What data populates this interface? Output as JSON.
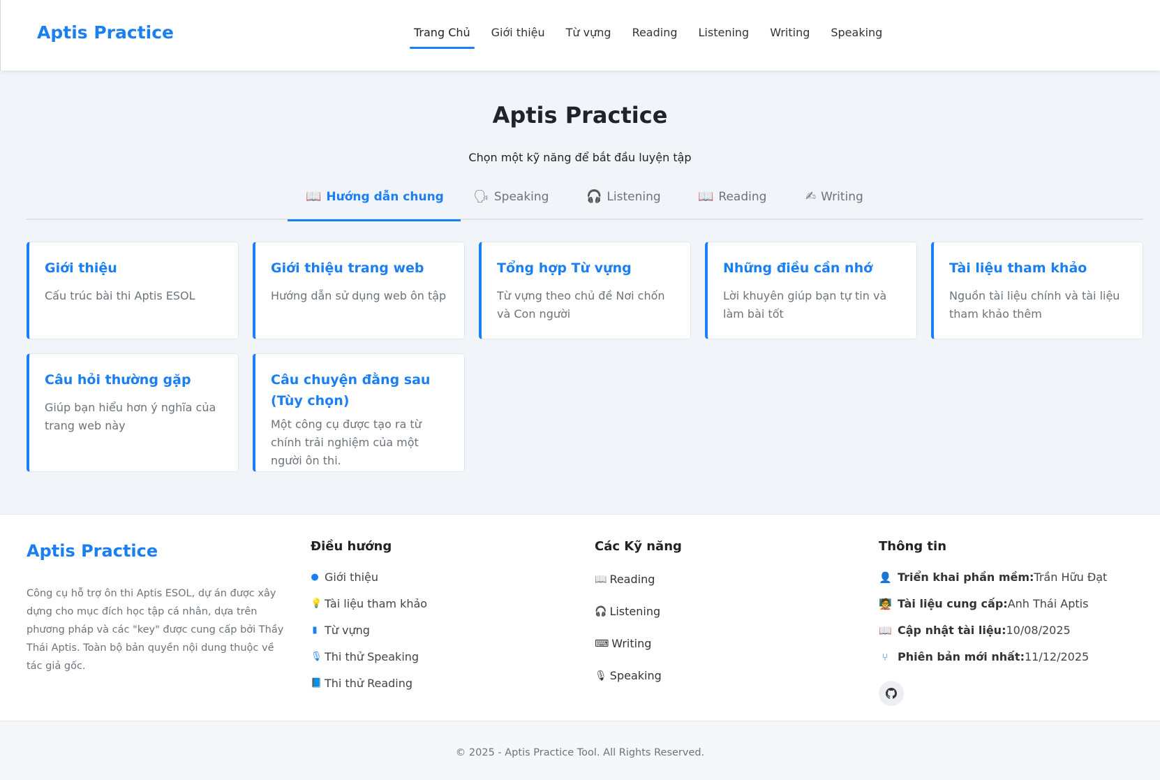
{
  "header": {
    "brand": "Aptis Practice",
    "nav": [
      "Trang Chủ",
      "Giới thiệu",
      "Từ vựng",
      "Reading",
      "Listening",
      "Writing",
      "Speaking"
    ]
  },
  "hero": {
    "title": "Aptis Practice",
    "subtitle": "Chọn một kỹ năng để bắt đầu luyện tập"
  },
  "tabs": [
    {
      "icon": "📖",
      "label": "Hướng dẫn chung"
    },
    {
      "icon": "🗣",
      "label": "Speaking"
    },
    {
      "icon": "🎧",
      "label": "Listening"
    },
    {
      "icon": "📖",
      "label": "Reading"
    },
    {
      "icon": "✍",
      "label": "Writing"
    }
  ],
  "cards": [
    {
      "title": "Giới thiệu",
      "desc": "Cấu trúc bài thi Aptis ESOL"
    },
    {
      "title": "Giới thiệu trang web",
      "desc": "Hướng dẫn sử dụng web ôn tập"
    },
    {
      "title": "Tổng hợp Từ vựng",
      "desc": "Từ vựng theo chủ đề Nơi chốn và Con người"
    },
    {
      "title": "Những điều cần nhớ",
      "desc": "Lời khuyên giúp bạn tự tin và làm bài tốt"
    },
    {
      "title": "Tài liệu tham khảo",
      "desc": "Nguồn tài liệu chính và tài liệu tham khảo thêm"
    },
    {
      "title": "Câu hỏi thường gặp",
      "desc": "Giúp bạn hiểu hơn ý nghĩa của trang web này"
    },
    {
      "title": "Câu chuyện đằng sau (Tùy chọn)",
      "desc": "Một công cụ được tạo ra từ chính trải nghiệm của một người ôn thi."
    }
  ],
  "footer": {
    "brand": "Aptis Practice",
    "description": "Công cụ hỗ trợ ôn thi Aptis ESOL, dự án được xây dựng cho mục đích học tập cá nhân, dựa trên phương pháp và các \"key\" được cung cấp bởi Thầy Thái Aptis. Toàn bộ bản quyền nội dung thuộc về tác giả gốc.",
    "nav_title": "Điều hướng",
    "nav_links": [
      {
        "icon": "info-circle-icon",
        "label": "Giới thiệu"
      },
      {
        "icon": "lightbulb-icon",
        "label": "Tài liệu tham khảo"
      },
      {
        "icon": "book-icon",
        "label": "Từ vựng"
      },
      {
        "icon": "microphone-icon",
        "label": "Thi thử Speaking"
      },
      {
        "icon": "reader-icon",
        "label": "Thi thử Reading"
      }
    ],
    "skills_title": "Các Kỹ năng",
    "skills": [
      {
        "icon": "reader-icon",
        "label": "Reading"
      },
      {
        "icon": "headphones-icon",
        "label": "Listening"
      },
      {
        "icon": "keyboard-icon",
        "label": "Writing"
      },
      {
        "icon": "microphone-icon",
        "label": "Speaking"
      }
    ],
    "info_title": "Thông tin",
    "info": [
      {
        "icon": "user-icon",
        "key": "Triển khai phần mềm:",
        "value": "Trần Hữu Đạt"
      },
      {
        "icon": "teacher-icon",
        "key": "Tài liệu cung cấp:",
        "value": "Anh Thái Aptis"
      },
      {
        "icon": "open-book-icon",
        "key": "Cập nhật tài liệu:",
        "value": "10/08/2025"
      },
      {
        "icon": "branch-icon",
        "key": "Phiên bản mới nhất:",
        "value": "11/12/2025"
      }
    ],
    "copyright": "© 2025 - Aptis Practice Tool. All Rights Reserved."
  },
  "colors": {
    "accent": "#1a7ff0",
    "background": "#f1f4f8",
    "muted": "#6c737b"
  }
}
